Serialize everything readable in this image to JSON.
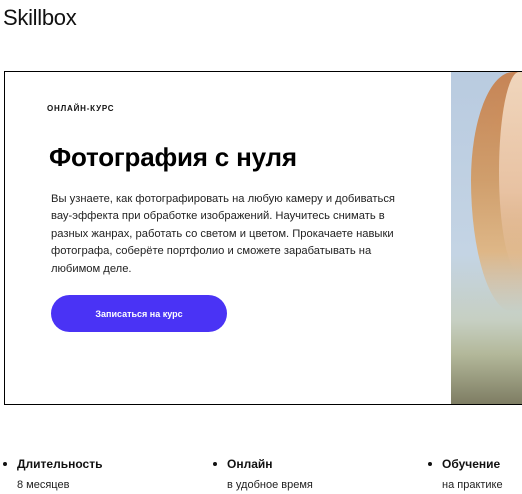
{
  "header": {
    "logo_text": "Skillbox"
  },
  "hero": {
    "badge": "ОНЛАЙН-КУРС",
    "title": "Фотография с нуля",
    "description": "Вы узнаете, как фотографировать на любую камеру и добиваться вау-эффекта при обработке изображений. Научитесь снимать в разных жанрах, работать со светом и цветом. Прокачаете навыки фотографа, соберёте портфолио и сможете зарабатывать на любимом деле.",
    "cta_label": "Записаться на курс",
    "accent_color": "#4a33f5"
  },
  "features": [
    {
      "title": "Длительность",
      "subtitle": "8 месяцев"
    },
    {
      "title": "Онлайн",
      "subtitle": "в удобное время"
    },
    {
      "title": "Обучение",
      "subtitle": "на практике"
    }
  ]
}
